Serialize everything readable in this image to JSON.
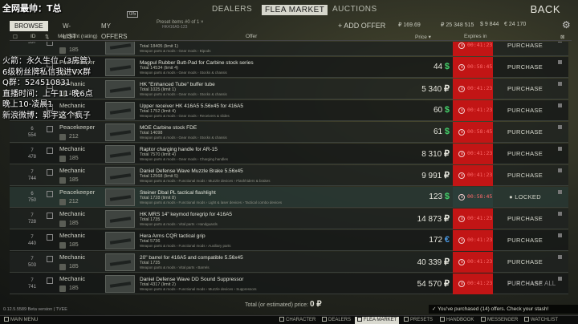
{
  "overlay": {
    "title": "全网最帅：T总",
    "lines": [
      "火箭：永久生位（3房管）",
      "6级粉丝牌私信我进VX群",
      "Q群：524510831",
      "直播时间：上午11-晚6点",
      "晚上10-凌晨1",
      "新浪微博：郭宇这个疯子"
    ]
  },
  "top_nav": {
    "dealers": "DEALERS",
    "flea_market": "FLEA MARKET",
    "auctions": "AUCTIONS",
    "back": "BACK"
  },
  "tabs": {
    "browse": "BROWSE",
    "wlist": "W-LIST",
    "my_offers": "MY OFFERS",
    "badge": "0/5",
    "preset_label": "Preset items #0 of 1 ×",
    "preset_sub": "HK416A5-123",
    "add_offer": "+ ADD OFFER",
    "currency_a": "₽ 169.69",
    "currency_b": "₽ 25 348 515",
    "currency_c": "$ 9 844",
    "currency_d": "€ 24 170"
  },
  "header": {
    "id": "ID",
    "merchant": "Merchant (rating)",
    "offer": "Offer",
    "price": "Price ▾",
    "expires": "Expires in"
  },
  "rows": [
    {
      "id": "537",
      "merchant": "",
      "rating": "185",
      "name": "",
      "qty": "Total 18405  (limit 1)",
      "cat": "Weapon parts & mods › Gear mods › Bipods",
      "price": "",
      "cur": "",
      "cur_class": "",
      "time": "00:41:23",
      "action": "PURCHASE",
      "locked": false
    },
    {
      "id": "",
      "merchant": "Peacekeeper",
      "rating": "185",
      "name": "Magpul Rubber Butt-Pad for Carbine stock series",
      "qty": "Total 14534  (limit 4)",
      "cat": "Weapon parts & mods › Gear mods › Stocks & chassis",
      "price": "44",
      "cur": "$",
      "cur_class": "cur-usd",
      "time": "00:58:45",
      "action": "PURCHASE",
      "locked": false
    },
    {
      "id": "",
      "merchant": "Mechanic",
      "rating": "185",
      "name": "HK \"Enhanced Tube\" buffer tube",
      "qty": "Total 1025  (limit 1)",
      "cat": "Weapon parts & mods › Gear mods › Stocks & chassis",
      "price": "5 340",
      "cur": "₽",
      "cur_class": "cur-rub",
      "time": "00:41:23",
      "action": "PURCHASE",
      "locked": false
    },
    {
      "id": "",
      "merchant": "Mechanic",
      "rating": "185",
      "name": "Upper receiver HK 416A5 5.56x45 for 416A5",
      "qty": "Total 1752  (limit 4)",
      "cat": "Weapon parts & mods › Gear mods › Receivers & slides",
      "price": "60",
      "cur": "$",
      "cur_class": "cur-usd",
      "time": "00:41:23",
      "action": "PURCHASE",
      "locked": false
    },
    {
      "id": "6\n554",
      "merchant": "Peacekeeper",
      "rating": "212",
      "name": "MOE Carbine stock FDE",
      "qty": "Total 14098",
      "cat": "Weapon parts & mods › Gear mods › Stocks & chassis",
      "price": "61",
      "cur": "$",
      "cur_class": "cur-usd",
      "time": "00:58:45",
      "action": "PURCHASE",
      "locked": false
    },
    {
      "id": "7\n478",
      "merchant": "Mechanic",
      "rating": "185",
      "name": "Raptor charging handle for AR-15",
      "qty": "Total 7570  (limit 4)",
      "cat": "Weapon parts & mods › Gear mods › Charging handles",
      "price": "8 310",
      "cur": "₽",
      "cur_class": "cur-rub",
      "time": "00:41:23",
      "action": "PURCHASE",
      "locked": false
    },
    {
      "id": "7\n744",
      "merchant": "Mechanic",
      "rating": "185",
      "name": "Daniel Defense Wave Muzzle Brake 5.56x45",
      "qty": "Total 12568  (limit 5)",
      "cat": "Weapon parts & mods › Functional mods › Muzzle devices › Flashhiders & brakes",
      "price": "9 991",
      "cur": "₽",
      "cur_class": "cur-rub",
      "time": "00:41:23",
      "action": "PURCHASE",
      "locked": false
    },
    {
      "id": "6\n750",
      "merchant": "Peacekeeper",
      "rating": "212",
      "name": "Steiner Dbal PL tactical flashlight",
      "qty": "Total 1728  (limit 8)",
      "cat": "Weapon parts & mods › Functional mods › Light & laser devices › Tactical combo devices",
      "price": "123",
      "cur": "$",
      "cur_class": "cur-usd",
      "time": "00:58:45",
      "action": "● LOCKED",
      "locked": true
    },
    {
      "id": "7\n728",
      "merchant": "Mechanic",
      "rating": "185",
      "name": "HK MRS 14\" keymod foregrip for 416A5",
      "qty": "Total 1735",
      "cat": "Weapon parts & mods › Vital parts › Handguards",
      "price": "14 873",
      "cur": "₽",
      "cur_class": "cur-rub",
      "time": "00:41:23",
      "action": "PURCHASE",
      "locked": false
    },
    {
      "id": "7\n440",
      "merchant": "Mechanic",
      "rating": "185",
      "name": "Hera Arms CQR tactical grip",
      "qty": "Total 5736",
      "cat": "Weapon parts & mods › Functional mods › Auxiliary parts",
      "price": "172",
      "cur": "€",
      "cur_class": "cur-eur",
      "time": "00:41:23",
      "action": "PURCHASE",
      "locked": false
    },
    {
      "id": "7\n503",
      "merchant": "Mechanic",
      "rating": "185",
      "name": "20\" barrel for 416A5 and compatible 5.56x45",
      "qty": "Total 1735",
      "cat": "Weapon parts & mods › Vital parts › Barrels",
      "price": "40 339",
      "cur": "₽",
      "cur_class": "cur-rub",
      "time": "00:41:23",
      "action": "PURCHASE",
      "locked": false
    },
    {
      "id": "7\n741",
      "merchant": "Mechanic",
      "rating": "185",
      "name": "Daniel Defense Wave DD Sound Suppressor",
      "qty": "Total 4317  (limit 2)",
      "cat": "Weapon parts & mods › Functional mods › Muzzle devices › Suppressors",
      "price": "54 570",
      "cur": "₽",
      "cur_class": "cur-rub",
      "time": "00:41:23",
      "action": "PURCHASE",
      "locked": false
    }
  ],
  "footer": {
    "purchase_all": "PURCHASE ALL",
    "total_label": "Total (or estimated) price:",
    "total_value": "0 ₽",
    "version": "0.12.5.5589 Beta version | TVEE",
    "notification": "✓ You've purchased (14) offers. Check your stash!"
  },
  "bottom_bar": {
    "main_menu": "MAIN MENU",
    "character": "CHARACTER",
    "dealers": "DEALERS",
    "flea_market": "FLEA MARKET",
    "presets": "PRESETS",
    "handbook": "HANDBOOK",
    "messenger": "MESSENGER",
    "watchlist": "WATCHLIST"
  }
}
